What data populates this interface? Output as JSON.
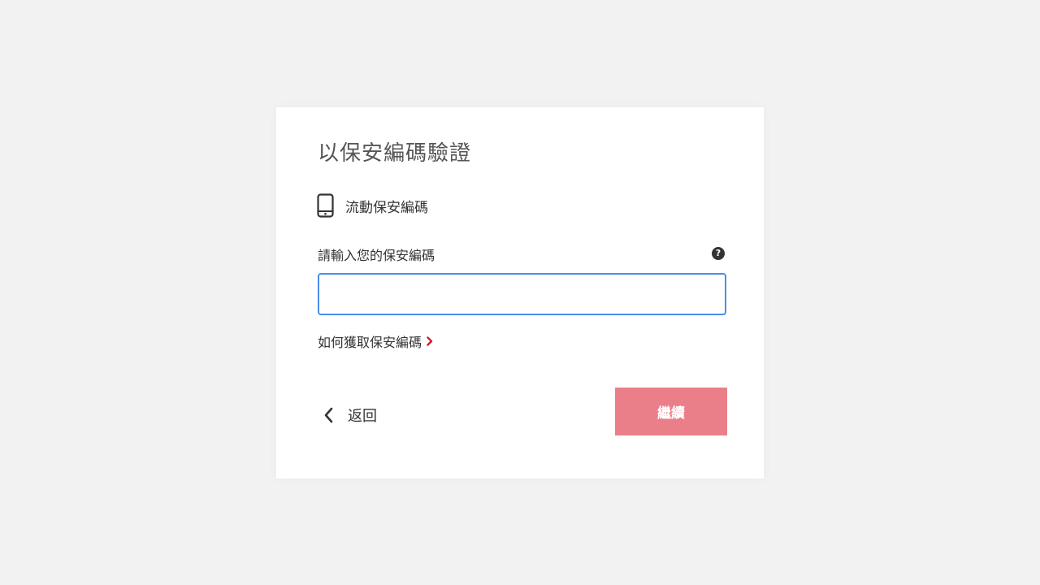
{
  "dialog": {
    "title": "以保安編碼驗證",
    "method_label": "流動保安編碼",
    "field_label": "請輸入您的保安編碼",
    "help_glyph": "?",
    "input_value": "",
    "input_placeholder": "",
    "how_to_link": "如何獲取保安編碼",
    "back_label": "返回",
    "continue_label": "繼續"
  },
  "icons": {
    "method": "mobile-phone-icon",
    "help": "question-circle-icon",
    "link_arrow": "chevron-right-icon",
    "back_arrow": "chevron-left-icon"
  },
  "colors": {
    "accent_red": "#d7192f",
    "button_bg": "#eb7f89",
    "input_focus_border": "#4a8ee8",
    "page_bg": "#f2f2f2"
  }
}
